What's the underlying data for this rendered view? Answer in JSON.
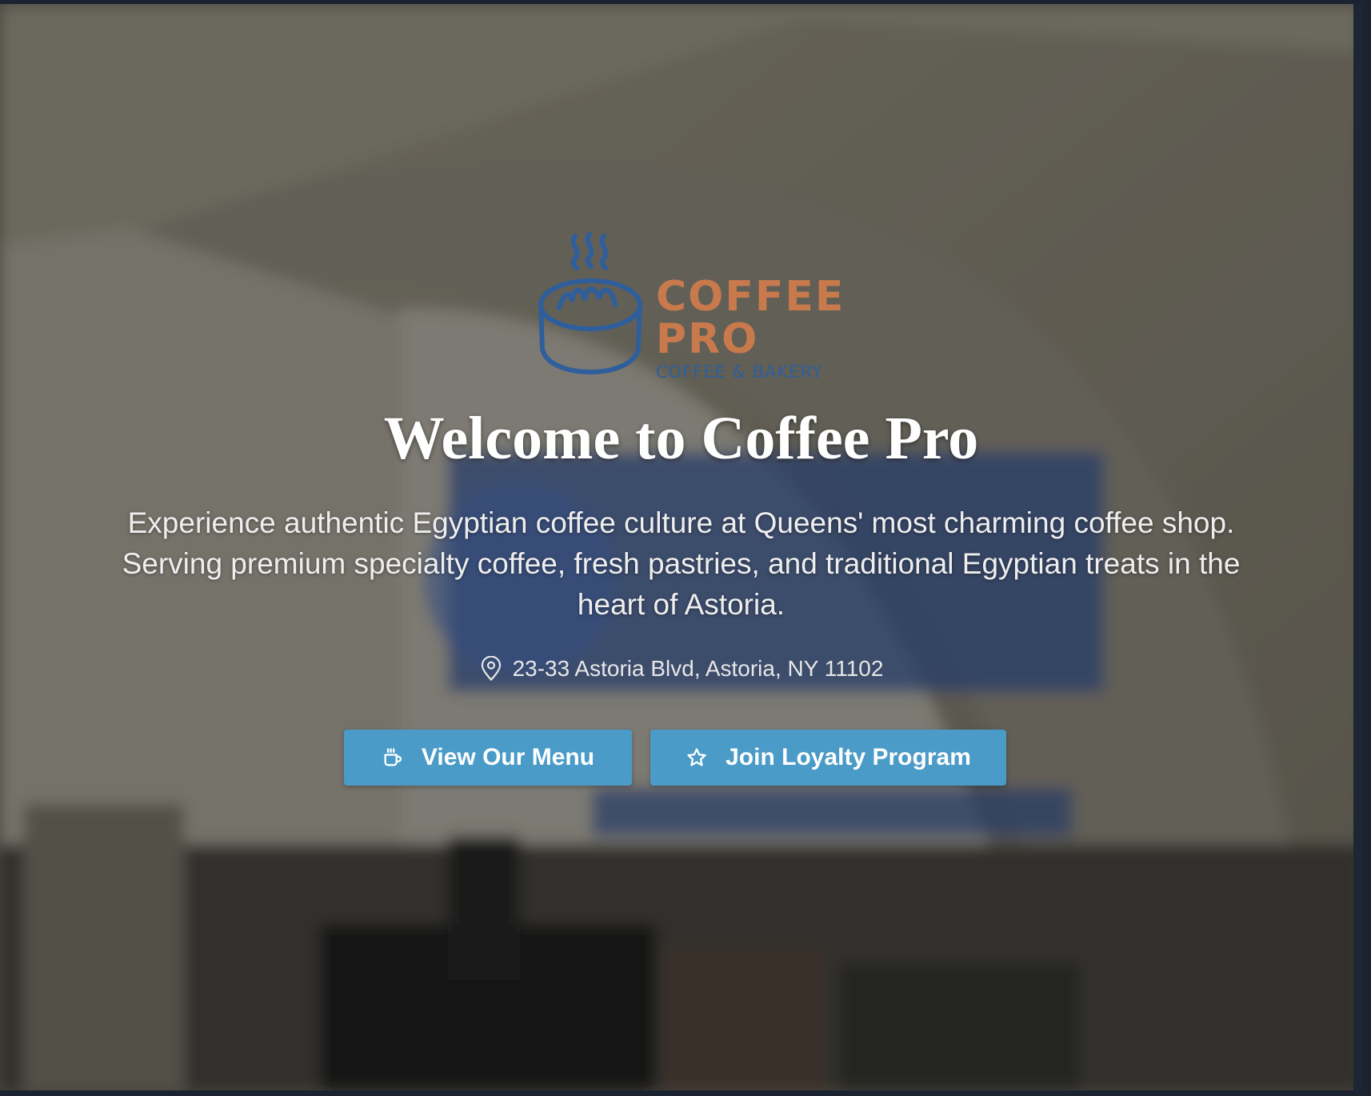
{
  "logo": {
    "line1": "COFFEE",
    "line2": "PRO",
    "subtitle": "COFFEE & BAKERY",
    "colors": {
      "brand": "#c97a4c",
      "cup": "#2e5f9c"
    }
  },
  "hero": {
    "title": "Welcome to Coffee Pro",
    "tagline": "Experience authentic Egyptian coffee culture at Queens' most charming coffee shop. Serving premium specialty coffee, fresh pastries, and traditional Egyptian treats in the heart of Astoria.",
    "address": "23-33 Astoria Blvd, Astoria, NY 11102",
    "address_icon": "map-pin-icon"
  },
  "buttons": {
    "menu": {
      "label": "View Our Menu",
      "icon": "coffee-cup-icon"
    },
    "loyalty": {
      "label": "Join Loyalty Program",
      "icon": "star-icon"
    },
    "color": "#4a9bc7"
  }
}
